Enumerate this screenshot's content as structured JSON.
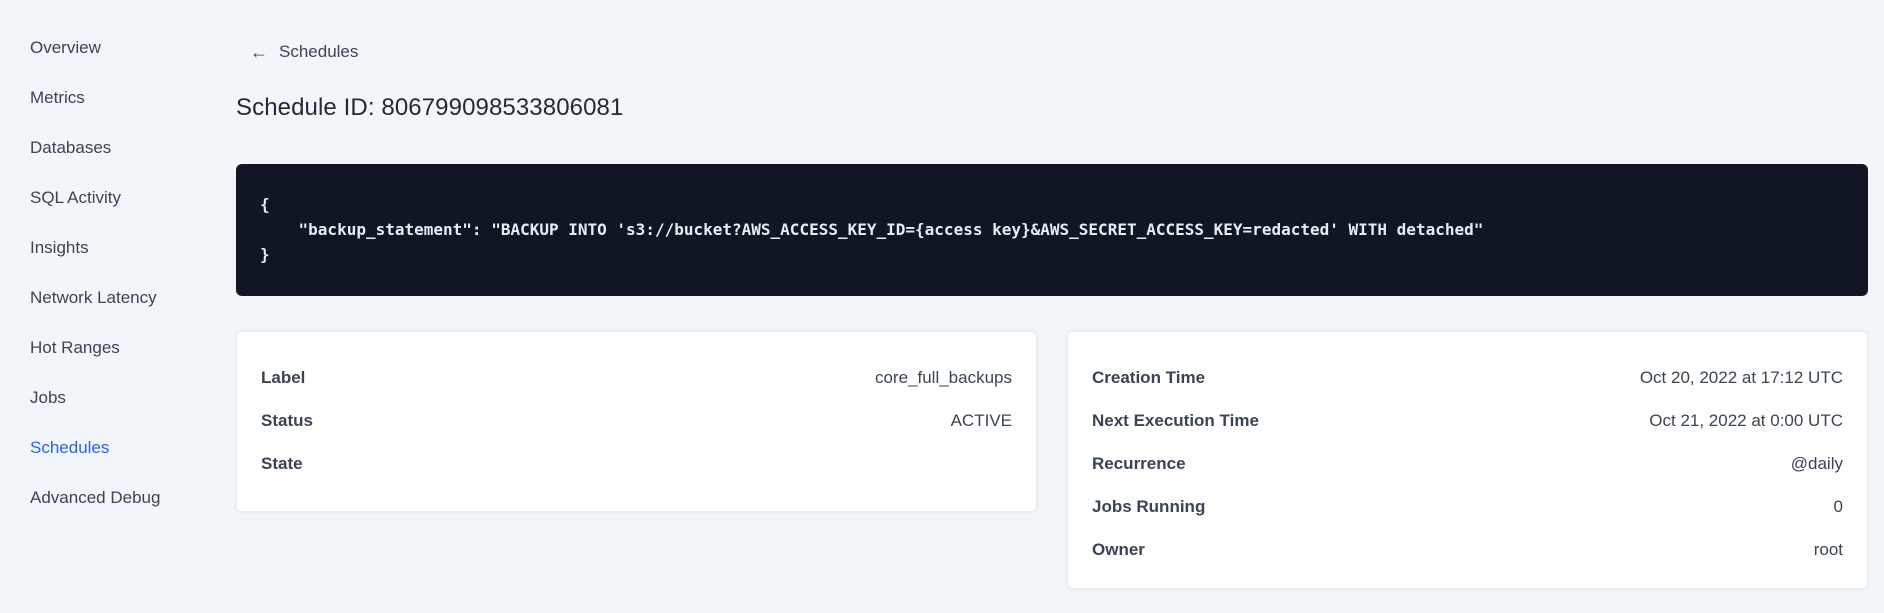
{
  "sidebar": {
    "items": [
      {
        "label": "Overview",
        "active": false
      },
      {
        "label": "Metrics",
        "active": false
      },
      {
        "label": "Databases",
        "active": false
      },
      {
        "label": "SQL Activity",
        "active": false
      },
      {
        "label": "Insights",
        "active": false
      },
      {
        "label": "Network Latency",
        "active": false
      },
      {
        "label": "Hot Ranges",
        "active": false
      },
      {
        "label": "Jobs",
        "active": false
      },
      {
        "label": "Schedules",
        "active": true
      },
      {
        "label": "Advanced Debug",
        "active": false
      }
    ]
  },
  "header": {
    "back_icon": "←",
    "back_label": "Schedules",
    "title": "Schedule ID: 806799098533806081"
  },
  "code_block": {
    "lines": [
      "{",
      "    \"backup_statement\": \"BACKUP INTO 's3://bucket?AWS_ACCESS_KEY_ID={access key}&AWS_SECRET_ACCESS_KEY=redacted' WITH detached\"",
      "}"
    ]
  },
  "details_card": {
    "rows": [
      {
        "label": "Label",
        "value": "core_full_backups"
      },
      {
        "label": "Status",
        "value": "ACTIVE"
      },
      {
        "label": "State",
        "value": ""
      }
    ]
  },
  "schedule_card": {
    "rows": [
      {
        "label": "Creation Time",
        "value": "Oct 20, 2022 at 17:12 UTC"
      },
      {
        "label": "Next Execution Time",
        "value": "Oct 21, 2022 at 0:00 UTC"
      },
      {
        "label": "Recurrence",
        "value": "@daily"
      },
      {
        "label": "Jobs Running",
        "value": "0"
      },
      {
        "label": "Owner",
        "value": "root"
      }
    ]
  },
  "colors": {
    "accent_blue": "#2563eb",
    "sidebar_text": "#394455",
    "code_background": "#101624",
    "code_text": "#e7ecf3",
    "page_background": "#f2f6fa",
    "card_background": "#ffffff"
  }
}
